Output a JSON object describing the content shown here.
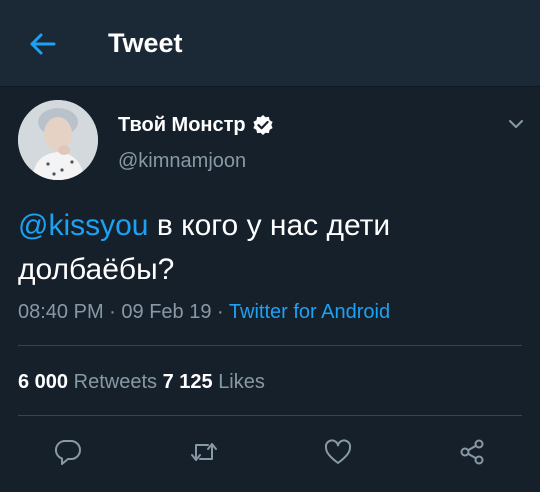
{
  "header": {
    "title": "Tweet"
  },
  "user": {
    "name": "Твой Монстр",
    "handle": "@kimnamjoon"
  },
  "tweet": {
    "mention": "@kissyou",
    "text": "в кого у нас дети долбаёбы?"
  },
  "meta": {
    "time": "08:40 PM",
    "sep1": " · ",
    "date": "09 Feb 19",
    "sep2": " · ",
    "source": "Twitter for Android"
  },
  "stats": {
    "retweets_count": "6 000",
    "retweets_label": "Retweets",
    "likes_count": "7 125",
    "likes_label": "Likes"
  },
  "icons": {
    "back": "arrow-left-icon",
    "verified": "verified-badge-icon",
    "menu": "chevron-down-icon",
    "reply": "reply-icon",
    "retweet": "retweet-icon",
    "like": "heart-icon",
    "share": "share-icon"
  },
  "colors": {
    "background": "#15202b",
    "header": "#1b2836",
    "accent": "#1da1f2",
    "secondary_text": "#8899a6",
    "divider": "#38444d"
  }
}
